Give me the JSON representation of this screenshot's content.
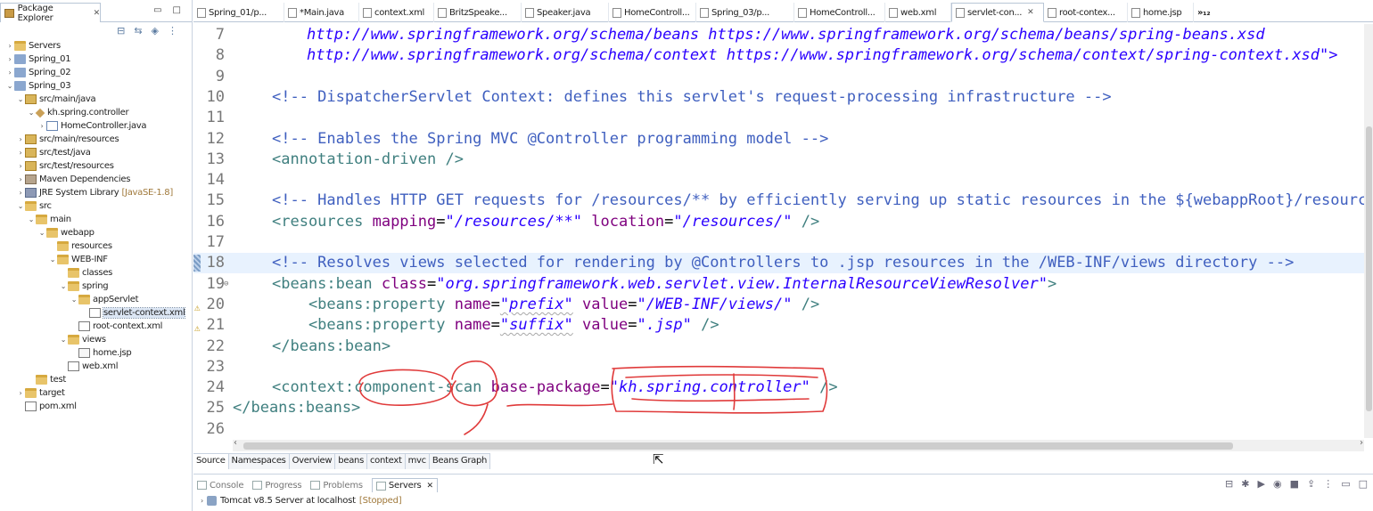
{
  "explorer": {
    "title": "Package Explorer",
    "close": "✕",
    "minimize": "▭",
    "maximize": "□",
    "items": [
      {
        "label": "Servers",
        "dec": "",
        "depth": 0,
        "toggle": "›",
        "icon": "folder"
      },
      {
        "label": "Spring_01",
        "dec": "",
        "depth": 0,
        "toggle": "›",
        "icon": "project"
      },
      {
        "label": "Spring_02",
        "dec": "",
        "depth": 0,
        "toggle": "›",
        "icon": "project"
      },
      {
        "label": "Spring_03",
        "dec": "",
        "depth": 0,
        "toggle": "⌄",
        "icon": "project"
      },
      {
        "label": "src/main/java",
        "dec": "",
        "depth": 1,
        "toggle": "⌄",
        "icon": "pkgroot"
      },
      {
        "label": "kh.spring.controller",
        "dec": "",
        "depth": 2,
        "toggle": "⌄",
        "icon": "pkg"
      },
      {
        "label": "HomeController.java",
        "dec": "",
        "depth": 3,
        "toggle": "›",
        "icon": "java"
      },
      {
        "label": "src/main/resources",
        "dec": "",
        "depth": 1,
        "toggle": "›",
        "icon": "pkgroot"
      },
      {
        "label": "src/test/java",
        "dec": "",
        "depth": 1,
        "toggle": "›",
        "icon": "pkgroot"
      },
      {
        "label": "src/test/resources",
        "dec": "",
        "depth": 1,
        "toggle": "›",
        "icon": "pkgroot"
      },
      {
        "label": "Maven Dependencies",
        "dec": "",
        "depth": 1,
        "toggle": "›",
        "icon": "lib"
      },
      {
        "label": "JRE System Library",
        "dec": "[JavaSE-1.8]",
        "depth": 1,
        "toggle": "›",
        "icon": "jre"
      },
      {
        "label": "src",
        "dec": "",
        "depth": 1,
        "toggle": "⌄",
        "icon": "folder"
      },
      {
        "label": "main",
        "dec": "",
        "depth": 2,
        "toggle": "⌄",
        "icon": "folder"
      },
      {
        "label": "webapp",
        "dec": "",
        "depth": 3,
        "toggle": "⌄",
        "icon": "folder"
      },
      {
        "label": "resources",
        "dec": "",
        "depth": 4,
        "toggle": "",
        "icon": "folder"
      },
      {
        "label": "WEB-INF",
        "dec": "",
        "depth": 4,
        "toggle": "⌄",
        "icon": "folder"
      },
      {
        "label": "classes",
        "dec": "",
        "depth": 5,
        "toggle": "",
        "icon": "folder"
      },
      {
        "label": "spring",
        "dec": "",
        "depth": 5,
        "toggle": "⌄",
        "icon": "folder"
      },
      {
        "label": "appServlet",
        "dec": "",
        "depth": 6,
        "toggle": "⌄",
        "icon": "folder"
      },
      {
        "label": "servlet-context.xml",
        "dec": "",
        "depth": 7,
        "toggle": "",
        "icon": "xml",
        "selected": true
      },
      {
        "label": "root-context.xml",
        "dec": "",
        "depth": 6,
        "toggle": "",
        "icon": "xml"
      },
      {
        "label": "views",
        "dec": "",
        "depth": 5,
        "toggle": "⌄",
        "icon": "folder"
      },
      {
        "label": "home.jsp",
        "dec": "",
        "depth": 6,
        "toggle": "",
        "icon": "jsp"
      },
      {
        "label": "web.xml",
        "dec": "",
        "depth": 5,
        "toggle": "",
        "icon": "xml"
      },
      {
        "label": "test",
        "dec": "",
        "depth": 2,
        "toggle": "",
        "icon": "folder"
      },
      {
        "label": "target",
        "dec": "",
        "depth": 1,
        "toggle": "›",
        "icon": "folder"
      },
      {
        "label": "pom.xml",
        "dec": "",
        "depth": 1,
        "toggle": "",
        "icon": "xml"
      }
    ]
  },
  "editor": {
    "tabs": [
      {
        "label": "Spring_01/p...",
        "active": false
      },
      {
        "label": "*Main.java",
        "active": false
      },
      {
        "label": "context.xml",
        "active": false
      },
      {
        "label": "BritzSpeake...",
        "active": false
      },
      {
        "label": "Speaker.java",
        "active": false
      },
      {
        "label": "HomeControll...",
        "active": false
      },
      {
        "label": "Spring_03/p...",
        "active": false
      },
      {
        "label": "HomeControll...",
        "active": false
      },
      {
        "label": "web.xml",
        "active": false
      },
      {
        "label": "servlet-con...",
        "active": true
      },
      {
        "label": "root-contex...",
        "active": false
      },
      {
        "label": "home.jsp",
        "active": false
      }
    ],
    "overflow": "»₁₂",
    "lines": [
      {
        "n": "7",
        "parts": [
          [
            "    ",
            ""
          ],
          [
            "http://www.springframework.org/schema/beans https://www.springframework.org/schema/beans/spring-beans.xsd",
            "url"
          ]
        ]
      },
      {
        "n": "8",
        "parts": [
          [
            "    ",
            ""
          ],
          [
            "http://www.springframework.org/schema/context https://www.springframework.org/schema/context/spring-context.xsd\">",
            "url"
          ]
        ]
      },
      {
        "n": "9",
        "parts": []
      },
      {
        "n": "10",
        "parts": [
          [
            "<!-- DispatcherServlet Context: defines this servlet's request-processing infrastructure -->",
            "cmt"
          ]
        ]
      },
      {
        "n": "11",
        "parts": []
      },
      {
        "n": "12",
        "parts": [
          [
            "<!-- Enables the Spring MVC @Controller programming model -->",
            "cmt"
          ]
        ]
      },
      {
        "n": "13",
        "parts": [
          [
            "<annotation-driven",
            "tag"
          ],
          [
            " />",
            "tag"
          ]
        ]
      },
      {
        "n": "14",
        "parts": []
      },
      {
        "n": "15",
        "parts": [
          [
            "<!-- Handles HTTP GET requests for /resources/** by efficiently serving up static resources in the ${webappRoot}/resources directory -->",
            "cmt"
          ]
        ]
      },
      {
        "n": "16",
        "parts": [
          [
            "<resources ",
            "tag"
          ],
          [
            "mapping",
            "attr"
          ],
          [
            "=",
            "pun"
          ],
          [
            "\"/resources/**\"",
            "val"
          ],
          [
            " location",
            "attr"
          ],
          [
            "=",
            "pun"
          ],
          [
            "\"/resources/\"",
            "val"
          ],
          [
            " />",
            "tag"
          ]
        ]
      },
      {
        "n": "17",
        "parts": []
      },
      {
        "n": "18",
        "parts": [
          [
            "<!-- Resolves views selected for rendering by @Controllers to .jsp resources in the /WEB-INF/views directory -->",
            "cmt"
          ]
        ],
        "current": true
      },
      {
        "n": "19",
        "parts": [
          [
            "<beans:bean ",
            "tag"
          ],
          [
            "class",
            "attr"
          ],
          [
            "=",
            "pun"
          ],
          [
            "\"org.springframework.web.servlet.view.InternalResourceViewResolver\"",
            "val"
          ],
          [
            ">",
            "tag"
          ]
        ],
        "fold": "⊖"
      },
      {
        "n": "20",
        "parts": [
          [
            "    <beans:property ",
            "tag"
          ],
          [
            "name",
            "attr"
          ],
          [
            "=",
            "pun"
          ],
          [
            "\"prefix\"",
            "valsq"
          ],
          [
            " value",
            "attr"
          ],
          [
            "=",
            "pun"
          ],
          [
            "\"/WEB-INF/views/\"",
            "val"
          ],
          [
            " />",
            "tag"
          ]
        ],
        "warn": true
      },
      {
        "n": "21",
        "parts": [
          [
            "    <beans:property ",
            "tag"
          ],
          [
            "name",
            "attr"
          ],
          [
            "=",
            "pun"
          ],
          [
            "\"suffix\"",
            "valsq"
          ],
          [
            " value",
            "attr"
          ],
          [
            "=",
            "pun"
          ],
          [
            "\".jsp\"",
            "val"
          ],
          [
            " />",
            "tag"
          ]
        ],
        "warn": true
      },
      {
        "n": "22",
        "parts": [
          [
            "</beans:bean>",
            "tag"
          ]
        ]
      },
      {
        "n": "23",
        "parts": []
      },
      {
        "n": "24",
        "parts": [
          [
            "<context:component-scan ",
            "tag"
          ],
          [
            "base-package",
            "attr"
          ],
          [
            "=",
            "pun"
          ],
          [
            "\"kh.spring.controller\"",
            "val"
          ],
          [
            " />",
            "tag"
          ]
        ]
      },
      {
        "n": "25",
        "parts": [
          [
            "</beans:beans>",
            "tag"
          ]
        ],
        "outdent": true
      },
      {
        "n": "26",
        "parts": []
      }
    ],
    "bottom_tabs": [
      {
        "label": "Source",
        "active": true
      },
      {
        "label": "Namespaces",
        "active": false
      },
      {
        "label": "Overview",
        "active": false
      },
      {
        "label": "beans",
        "active": false
      },
      {
        "label": "context",
        "active": false
      },
      {
        "label": "mvc",
        "active": false
      },
      {
        "label": "Beans Graph",
        "active": false
      }
    ]
  },
  "views": {
    "tabs": [
      {
        "label": "Console",
        "active": false
      },
      {
        "label": "Progress",
        "active": false
      },
      {
        "label": "Problems",
        "active": false
      },
      {
        "label": "Servers",
        "active": true
      }
    ],
    "server": {
      "name": "Tomcat v8.5 Server at localhost",
      "status": "[Stopped]"
    }
  }
}
